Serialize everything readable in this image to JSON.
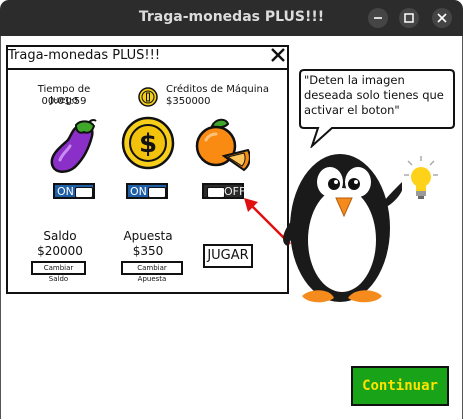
{
  "window": {
    "title": "Traga-monedas PLUS!!!"
  },
  "panel": {
    "title": "Traga-monedas PLUS!!!",
    "time_label": "Tiempo de Juego",
    "time_value": "00:01:59",
    "credits_label": "Créditos de Máquina",
    "credits_value": "$350000",
    "slots": [
      {
        "icon": "eggplant-icon",
        "toggle": "ON"
      },
      {
        "icon": "dollar-coin-icon",
        "toggle": "ON"
      },
      {
        "icon": "orange-icon",
        "toggle": "OFF"
      }
    ],
    "balance_label": "Saldo",
    "balance_value": "$20000",
    "change_balance_label": "Cambiar Saldo",
    "bet_label": "Apuesta",
    "bet_value": "$350",
    "change_bet_label": "Cambiar Apuesta",
    "play_label": "JUGAR"
  },
  "speech_bubble": {
    "text": "\"Deten la imagen deseada solo tienes que activar el boton\""
  },
  "continue_label": "Continuar",
  "colors": {
    "toggle_on": "#1f5fa8",
    "toggle_off": "#2b2b2b",
    "continue_bg": "#19a319",
    "continue_text": "#ffe200",
    "arrow": "#e01010"
  }
}
